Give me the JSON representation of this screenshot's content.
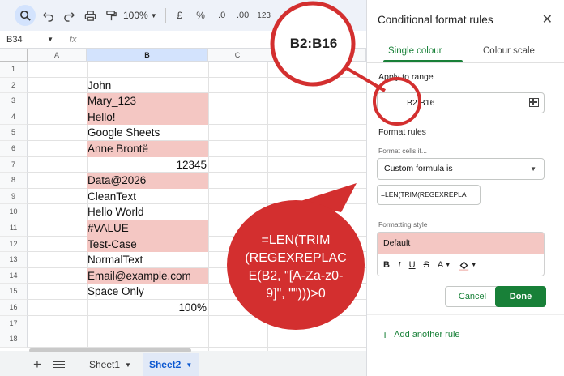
{
  "toolbar": {
    "zoom": "100%",
    "currency": "£",
    "percent": "%",
    "decimal_decrease": ".0",
    "decimal_increase": ".00",
    "more_formats": "123"
  },
  "formula_bar": {
    "cell_ref": "B34",
    "fx": "fx"
  },
  "grid": {
    "columns": [
      "A",
      "B",
      "C"
    ],
    "rows": [
      "1",
      "2",
      "3",
      "4",
      "5",
      "6",
      "7",
      "8",
      "9",
      "10",
      "11",
      "12",
      "13",
      "14",
      "15",
      "16",
      "17",
      "18"
    ],
    "cells": [
      {
        "row": 2,
        "text": "John",
        "highlight": false,
        "align": "left"
      },
      {
        "row": 3,
        "text": "Mary_123",
        "highlight": true,
        "align": "left"
      },
      {
        "row": 4,
        "text": "Hello!",
        "highlight": true,
        "align": "left"
      },
      {
        "row": 5,
        "text": "Google Sheets",
        "highlight": false,
        "align": "left"
      },
      {
        "row": 6,
        "text": "Anne Brontë",
        "highlight": true,
        "align": "left"
      },
      {
        "row": 7,
        "text": "12345",
        "highlight": false,
        "align": "right"
      },
      {
        "row": 8,
        "text": "Data@2026",
        "highlight": true,
        "align": "left"
      },
      {
        "row": 9,
        "text": "CleanText",
        "highlight": false,
        "align": "left"
      },
      {
        "row": 10,
        "text": "Hello World",
        "highlight": false,
        "align": "left"
      },
      {
        "row": 11,
        "text": "#VALUE",
        "highlight": true,
        "align": "left"
      },
      {
        "row": 12,
        "text": "Test-Case",
        "highlight": true,
        "align": "left"
      },
      {
        "row": 13,
        "text": "NormalText",
        "highlight": false,
        "align": "left"
      },
      {
        "row": 14,
        "text": "Email@example.com",
        "highlight": true,
        "align": "left"
      },
      {
        "row": 15,
        "text": "Space Only",
        "highlight": false,
        "align": "left"
      },
      {
        "row": 16,
        "text": "100%",
        "highlight": false,
        "align": "right"
      }
    ],
    "highlight_color": "#f4c7c3"
  },
  "sheets": {
    "tab1": "Sheet1",
    "tab2": "Sheet2",
    "active": "Sheet2"
  },
  "panel": {
    "title": "Conditional format rules",
    "tab_single": "Single colour",
    "tab_scale": "Colour scale",
    "apply_label": "Apply to range",
    "range": "B2:B16",
    "format_rules_label": "Format rules",
    "format_cells_if": "Format cells if...",
    "condition": "Custom formula is",
    "formula_value": "=LEN(TRIM(REGEXREPLA",
    "formatting_style_label": "Formatting style",
    "style_preview": "Default",
    "cancel": "Cancel",
    "done": "Done",
    "add_rule": "Add another rule",
    "accent": "#188038"
  },
  "callouts": {
    "magnifier_text": "B2:B16",
    "bubble_lines": [
      "=LEN(TRIM",
      "(REGEXREPLAC",
      "E(B2, \"[A-Za-z0-",
      "9]\", \"\")))>0"
    ],
    "bubble_color": "#d32f2f"
  }
}
